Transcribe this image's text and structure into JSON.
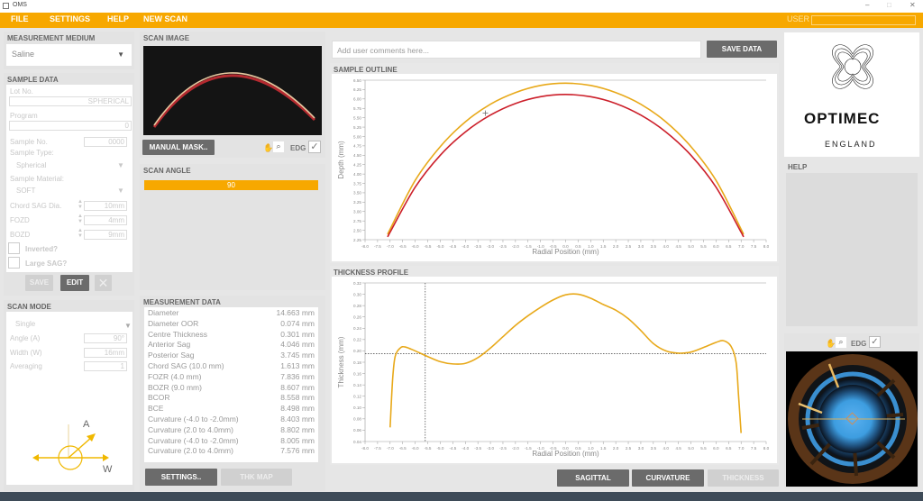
{
  "window": {
    "title": "OMS",
    "minimize": "–",
    "maximize": "□",
    "close": "✕"
  },
  "menu": {
    "items": [
      "FILE",
      "SETTINGS",
      "HELP",
      "NEW SCAN"
    ],
    "user_label": "USER",
    "user_value": ""
  },
  "colors": {
    "accent": "#f7a800",
    "anterior": "#e8a91a",
    "posterior": "#cc1f2a",
    "dark_button": "#6b6b6b"
  },
  "measurement_medium": {
    "title": "MEASUREMENT MEDIUM",
    "value": "Saline"
  },
  "sample_data": {
    "title": "SAMPLE DATA",
    "lot_no_label": "Lot No.",
    "lot_no": "SPHERICAL",
    "program_label": "Program",
    "program": "0",
    "sample_no_label": "Sample No.",
    "sample_no": "0000",
    "sample_type_label": "Sample Type:",
    "sample_type": "Spherical",
    "sample_material_label": "Sample Material:",
    "sample_material": "SOFT",
    "chord_label": "Chord SAG Dia.",
    "chord": "10mm",
    "fozd_label": "FOZD",
    "fozd": "4mm",
    "bozd_label": "BOZD",
    "bozd": "9mm",
    "inverted_label": "Inverted?",
    "large_sag_label": "Large SAG?",
    "save": "SAVE",
    "edit": "EDIT"
  },
  "scan_mode": {
    "title": "SCAN MODE",
    "mode": "Single",
    "angle_label": "Angle (A)",
    "angle": "90°",
    "width_label": "Width (W)",
    "width": "16mm",
    "averaging_label": "Averaging",
    "averaging": "1",
    "diagram_a": "A",
    "diagram_w": "W"
  },
  "scan_image": {
    "title": "SCAN IMAGE",
    "manual_mask": "MANUAL MASK..",
    "edg": "EDG"
  },
  "scan_angle": {
    "title": "SCAN ANGLE",
    "value": "90",
    "progress_percent": 100
  },
  "measurement_data": {
    "title": "MEASUREMENT DATA",
    "rows": [
      [
        "Diameter",
        "14.663 mm"
      ],
      [
        "Diameter OOR",
        "0.074 mm"
      ],
      [
        "Centre Thickness",
        "0.301 mm"
      ],
      [
        "Anterior Sag",
        "4.046 mm"
      ],
      [
        "Posterior Sag",
        "3.745 mm"
      ],
      [
        "Chord SAG (10.0 mm)",
        "1.613 mm"
      ],
      [
        "FOZR (4.0 mm)",
        "7.836 mm"
      ],
      [
        "BOZR (9.0 mm)",
        "8.607 mm"
      ],
      [
        "BCOR",
        "8.558 mm"
      ],
      [
        "BCE",
        "8.498 mm"
      ],
      [
        "Curvature (-4.0 to -2.0mm)",
        "8.403 mm"
      ],
      [
        "Curvature (2.0 to 4.0mm)",
        "8.802 mm"
      ],
      [
        "Curvature (-4.0 to -2.0mm)",
        "8.005 mm"
      ],
      [
        "Curvature (2.0 to 4.0mm)",
        "7.576 mm"
      ]
    ],
    "settings": "SETTINGS..",
    "thk_map": "THK MAP"
  },
  "comments": {
    "placeholder": "Add user comments here...",
    "save_data": "SAVE DATA"
  },
  "bottom_buttons": [
    "SAGITTAL",
    "CURVATURE",
    "THICKNESS"
  ],
  "logo": {
    "brand": "OPTIMEC",
    "sub": "ENGLAND"
  },
  "help": {
    "title": "HELP"
  },
  "map": {
    "edg": "EDG"
  },
  "chart_data": [
    {
      "type": "line",
      "title": "SAMPLE OUTLINE",
      "xlabel": "Radial Position (mm)",
      "ylabel": "Depth (mm)",
      "xlim": [
        -8,
        8
      ],
      "ylim": [
        2.25,
        6.5
      ],
      "xstep": 0.5,
      "ystep": 0.25,
      "grid": false,
      "series": [
        {
          "x": [
            -7.05,
            -7,
            -6,
            -5,
            -4,
            -3,
            -2,
            -1,
            0,
            1,
            2,
            3,
            4,
            5,
            6,
            7,
            7.05
          ],
          "y": [
            2.45,
            2.53,
            3.83,
            4.73,
            5.39,
            5.86,
            6.17,
            6.36,
            6.42,
            6.36,
            6.17,
            5.86,
            5.39,
            4.73,
            3.83,
            2.53,
            2.45
          ],
          "color": "#e8a91a"
        },
        {
          "x": [
            -7.05,
            -7,
            -6,
            -5,
            -4,
            -3,
            -2,
            -1,
            0,
            1,
            2,
            3,
            4,
            5,
            6,
            7,
            7.05
          ],
          "y": [
            2.38,
            2.45,
            3.65,
            4.5,
            5.12,
            5.57,
            5.88,
            6.06,
            6.12,
            6.06,
            5.88,
            5.57,
            5.12,
            4.5,
            3.65,
            2.45,
            2.38
          ],
          "color": "#cc1f2a"
        }
      ],
      "marker": {
        "x": -3.2,
        "y": 5.62
      }
    },
    {
      "type": "line",
      "title": "THICKNESS PROFILE",
      "xlabel": "Radial Position (mm)",
      "ylabel": "Thickness (mm)",
      "xlim": [
        -8,
        8
      ],
      "ylim": [
        0.04,
        0.32
      ],
      "xstep": 0.5,
      "ystep": 0.02,
      "grid": false,
      "series": [
        {
          "x": [
            -7,
            -6.9,
            -6.8,
            -6.6,
            -6.4,
            -6,
            -5.5,
            -5,
            -4.5,
            -4,
            -3.5,
            -3,
            -2.5,
            -2,
            -1.5,
            -1,
            -0.5,
            0,
            0.5,
            1,
            1.5,
            2,
            2.5,
            3,
            3.5,
            4,
            4.5,
            5,
            5.5,
            6,
            6.3,
            6.6,
            6.8,
            6.9,
            7
          ],
          "y": [
            0.065,
            0.15,
            0.19,
            0.205,
            0.207,
            0.2,
            0.19,
            0.181,
            0.177,
            0.178,
            0.188,
            0.205,
            0.225,
            0.245,
            0.262,
            0.277,
            0.29,
            0.299,
            0.3,
            0.293,
            0.282,
            0.272,
            0.257,
            0.236,
            0.213,
            0.2,
            0.196,
            0.198,
            0.206,
            0.215,
            0.218,
            0.208,
            0.18,
            0.12,
            0.055
          ],
          "color": "#e8a91a"
        }
      ],
      "crosshair": {
        "x": -5.6,
        "y": 0.195
      }
    }
  ]
}
